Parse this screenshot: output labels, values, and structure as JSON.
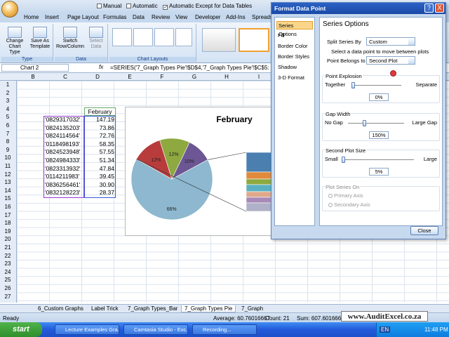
{
  "qat": {
    "manual": "Manual",
    "automatic": "Automatic",
    "auto_except": "Automatic Except for Data Tables"
  },
  "tabs": [
    "Home",
    "Insert",
    "Page Layout",
    "Formulas",
    "Data",
    "Review",
    "View",
    "Developer",
    "Add-Ins",
    "Spreadsheet"
  ],
  "ribbon": {
    "change_chart_type": "Change Chart Type",
    "save_as_template": "Save As Template",
    "type_group": "Type",
    "switch_row_col": "Switch Row/Column",
    "select_data": "Select Data",
    "data_group": "Data",
    "chart_layouts_group": "Chart Layouts"
  },
  "formula_bar": {
    "name_box": "Chart 2",
    "fx": "fx",
    "formula": "=SERIES('7_Graph Types Pie'!$D$4,'7_Graph Types Pie'!$C$5:"
  },
  "columns": [
    "B",
    "C",
    "D",
    "E",
    "F",
    "G",
    "H",
    "I"
  ],
  "rows": [
    "1",
    "2",
    "3",
    "4",
    "5",
    "6",
    "7",
    "8",
    "9",
    "10",
    "11",
    "12",
    "13",
    "14",
    "15",
    "16",
    "17",
    "18",
    "19",
    "20",
    "21",
    "22",
    "23",
    "24",
    "25",
    "26",
    "27"
  ],
  "sheet": {
    "header": "February",
    "codes": [
      "'0829317032'",
      "'0824135203'",
      "'0824114564'",
      "'0118498193'",
      "'0824523948'",
      "'0824984333'",
      "'0823313932'",
      "'0114211983'",
      "'0836256461'",
      "'0832128223'"
    ],
    "values": [
      "147.19",
      "73.86",
      "72.76",
      "58.35",
      "57.55",
      "51.34",
      "47.84",
      "39.45",
      "30.90",
      "28.37"
    ]
  },
  "chart_data": {
    "type": "pie",
    "title": "February",
    "slices": [
      {
        "label": "66%",
        "value": 66,
        "color": "#8db8cf"
      },
      {
        "label": "12%",
        "value": 12,
        "color": "#b83c3c"
      },
      {
        "label": "12%",
        "value": 12,
        "color": "#8da93f"
      },
      {
        "label": "10%",
        "value": 10,
        "color": "#6c5693"
      }
    ],
    "secondary_bar_colors": [
      "#4a7fb0",
      "#e08a3c",
      "#8da93f",
      "#5ab0c0",
      "#e0a88a",
      "#a88ab8",
      "#b0b0c8"
    ]
  },
  "sheet_tabs": [
    "6_Custom Graphs",
    "Label Trick",
    "7_Graph Types_Bar",
    "7_Graph Types Pie",
    "7_Graph"
  ],
  "status": {
    "ready": "Ready",
    "average": "Average: 60.76016667",
    "count": "Count: 21",
    "sum": "Sum: 607.6016667"
  },
  "dialog": {
    "title": "Format Data Point",
    "help": "?",
    "close_x": "X",
    "nav": [
      "Series Options",
      "Fill",
      "Border Color",
      "Border Styles",
      "Shadow",
      "3-D Format"
    ],
    "heading": "Series Options",
    "split_by_label": "Split Series By",
    "split_by_value": "Custom",
    "select_hint": "Select a data point to move between plots",
    "belongs_label": "Point Belongs to",
    "belongs_value": "Second Plot",
    "explosion": {
      "title": "Point Explosion",
      "left": "Together",
      "right": "Separate",
      "value": "0%",
      "fraction": 0
    },
    "gap": {
      "title": "Gap Width",
      "left": "No Gap",
      "right": "Large Gap",
      "value": "150%",
      "fraction": 0.3
    },
    "second_size": {
      "title": "Second Plot Size",
      "left": "Small",
      "right": "Large",
      "value": "5%",
      "fraction": 0.0
    },
    "series_on": {
      "title": "Plot Series On",
      "primary": "Primary Axis",
      "secondary": "Secondary Axis"
    },
    "close": "Close"
  },
  "taskbar": {
    "start": "start",
    "items": [
      "Lecture Examples Gra...",
      "Camtasia Studio - Exc...",
      "Recording..."
    ],
    "lang": "EN",
    "time": "11:48 PM"
  },
  "watermark": "www.AuditExcel.co.za"
}
